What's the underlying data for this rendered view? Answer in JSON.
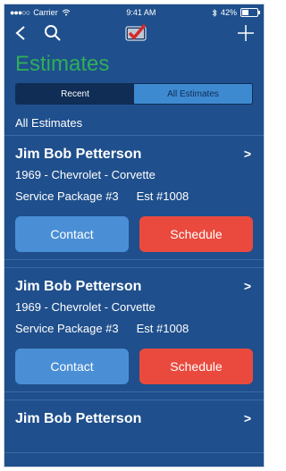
{
  "status_bar": {
    "carrier": "Carrier",
    "time": "9:41 AM",
    "battery": "42%",
    "signal_dots": "●●●○○"
  },
  "nav": {
    "icons": [
      "back-icon",
      "search-icon",
      "checkmark-logo-icon",
      "add-icon"
    ]
  },
  "page": {
    "title": "Estimates"
  },
  "tabs": [
    {
      "label": "Recent",
      "active": true
    },
    {
      "label": "All Estimates",
      "active": false
    }
  ],
  "section_header": "All Estimates",
  "estimates": [
    {
      "name": "Jim Bob Petterson",
      "vehicle": "1969 - Chevrolet - Corvette",
      "package": "Service Package #3",
      "estimate_no": "Est #1008",
      "contact_label": "Contact",
      "schedule_label": "Schedule",
      "chevron": ">"
    },
    {
      "name": "Jim Bob Petterson",
      "vehicle": "1969 - Chevrolet - Corvette",
      "package": "Service Package #3",
      "estimate_no": "Est #1008",
      "contact_label": "Contact",
      "schedule_label": "Schedule",
      "chevron": ">"
    },
    {
      "name": "Jim Bob Petterson",
      "chevron": ">"
    }
  ],
  "colors": {
    "background": "#1f4f8c",
    "title_green": "#2fae5a",
    "contact_button": "#4a8fd6",
    "schedule_button": "#e94a3d",
    "segment_active": "#0f2d55",
    "segment_inactive": "#3e8ad1"
  }
}
